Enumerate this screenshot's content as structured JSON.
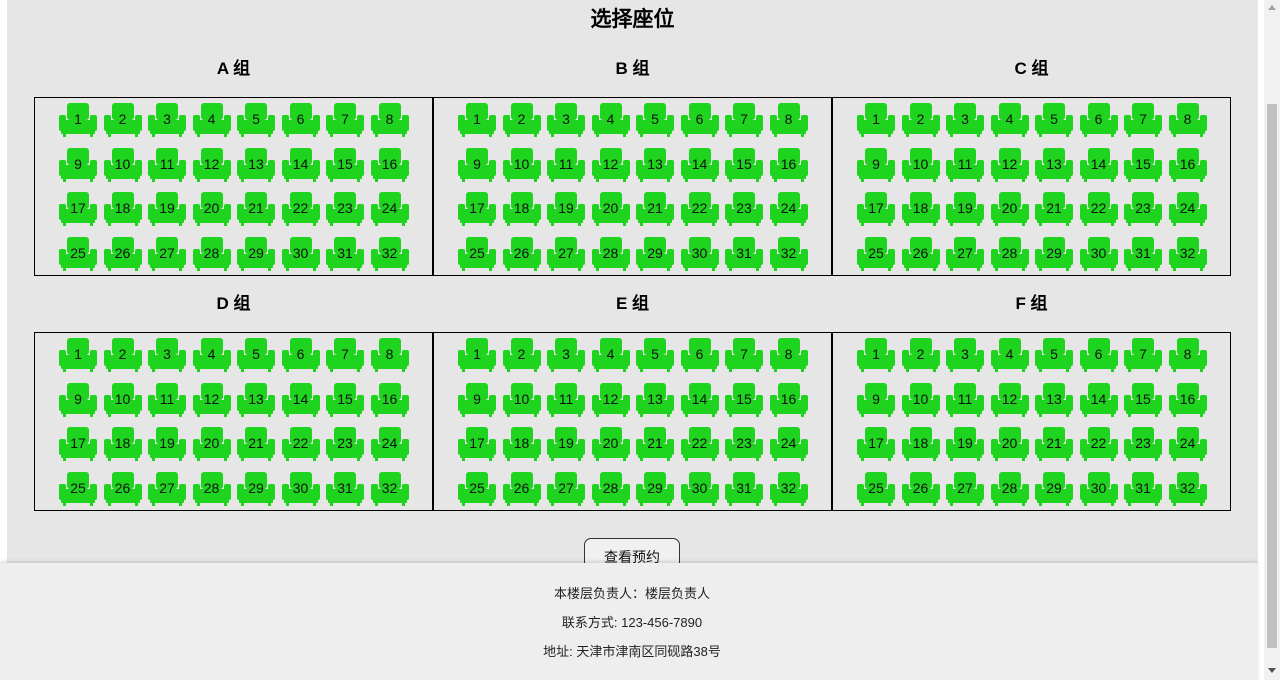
{
  "page_title": "选择座位",
  "groups": [
    {
      "label": "A 组"
    },
    {
      "label": "B 组"
    },
    {
      "label": "C 组"
    },
    {
      "label": "D 组"
    },
    {
      "label": "E 组"
    },
    {
      "label": "F 组"
    }
  ],
  "seats_per_group": [
    "1",
    "2",
    "3",
    "4",
    "5",
    "6",
    "7",
    "8",
    "9",
    "10",
    "11",
    "12",
    "13",
    "14",
    "15",
    "16",
    "17",
    "18",
    "19",
    "20",
    "21",
    "22",
    "23",
    "24",
    "25",
    "26",
    "27",
    "28",
    "29",
    "30",
    "31",
    "32"
  ],
  "seat_color": "#1ed41e",
  "view_button_label": "查看预约",
  "footer": {
    "manager": "本楼层负责人：楼层负责人",
    "contact": "联系方式: 123-456-7890",
    "address": "地址: 天津市津南区同砚路38号"
  },
  "scrollbar_icons": [
    "arrow-up-icon",
    "arrow-down-icon"
  ]
}
